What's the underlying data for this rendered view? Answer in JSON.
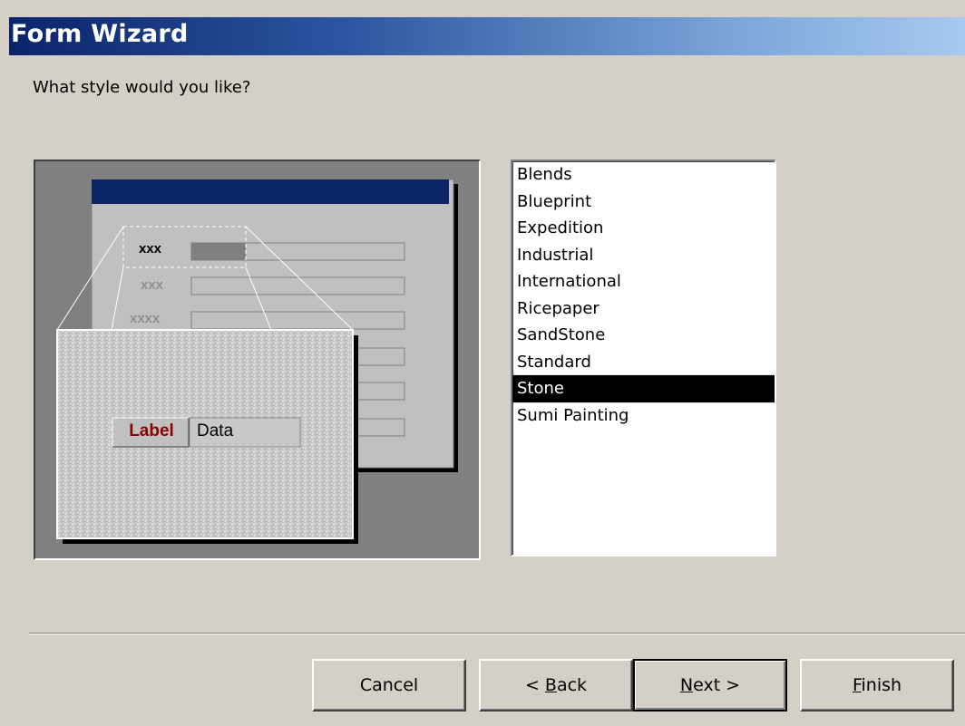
{
  "window": {
    "title": "Form Wizard"
  },
  "question": "What style would you like?",
  "preview": {
    "sample_field_labels": [
      "xxx",
      "xxx",
      "xxxx"
    ],
    "label_text": "Label",
    "data_text": "Data"
  },
  "styles": {
    "items": [
      "Blends",
      "Blueprint",
      "Expedition",
      "Industrial",
      "International",
      "Ricepaper",
      "SandStone",
      "Standard",
      "Stone",
      "Sumi Painting"
    ],
    "selected": "Stone"
  },
  "buttons": {
    "cancel": "Cancel",
    "back_prefix": "< ",
    "back_mnemonic": "B",
    "back_rest": "ack",
    "next_mnemonic": "N",
    "next_rest": "ext >",
    "finish_mnemonic": "F",
    "finish_rest": "inish"
  },
  "colors": {
    "title_gradient_start": "#0a246a",
    "title_gradient_end": "#a6caf0",
    "dialog_bg": "#d4d0c8",
    "label_text": "#8b0000",
    "selection_bg": "#000000"
  }
}
